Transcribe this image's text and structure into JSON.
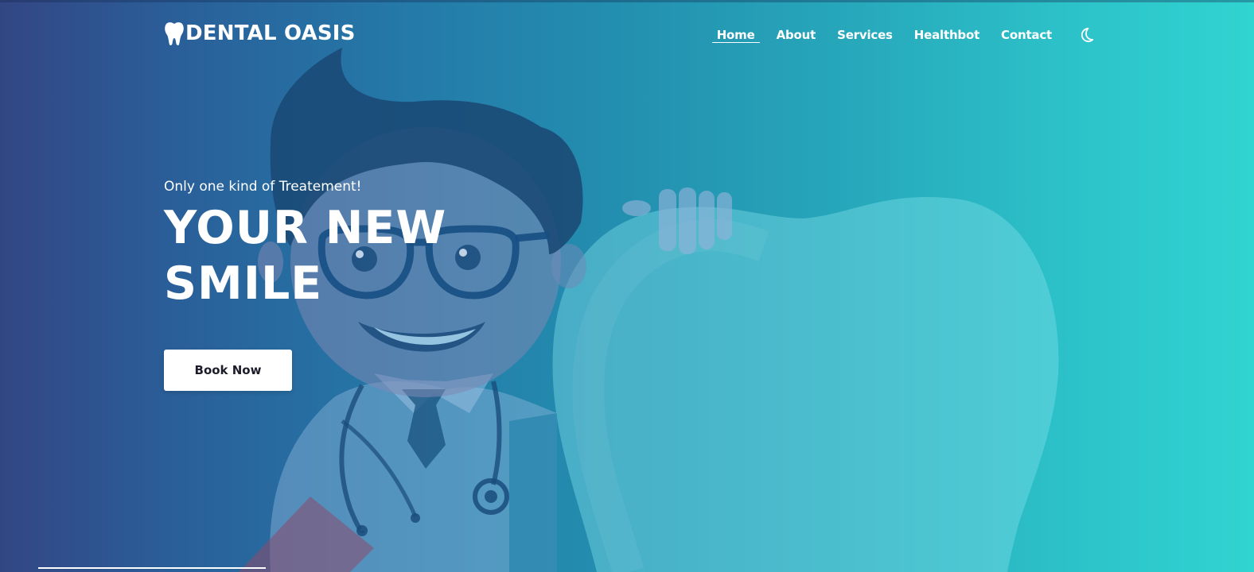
{
  "brand": {
    "name": "DENTAL OASIS",
    "icon": "tooth-icon"
  },
  "nav": {
    "items": [
      {
        "label": "Home",
        "active": true
      },
      {
        "label": "About"
      },
      {
        "label": "Services"
      },
      {
        "label": "Healthbot"
      },
      {
        "label": "Contact"
      }
    ],
    "theme_toggle_icon": "moon-icon"
  },
  "hero": {
    "tagline": "Only one kind of Treatement!",
    "headline_line1": "YOUR NEW",
    "headline_line2": "SMILE",
    "cta_label": "Book Now"
  },
  "colors": {
    "gradient_start": "#334684",
    "gradient_end": "#30d4d1",
    "text": "#ffffff",
    "button_bg": "#ffffff",
    "button_text": "#1c1c2a"
  }
}
